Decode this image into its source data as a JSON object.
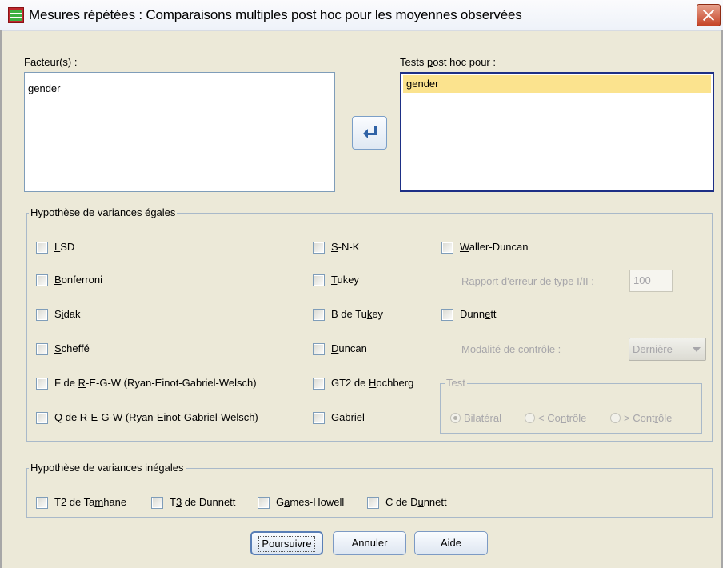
{
  "window": {
    "title": "Mesures répétées : Comparaisons multiples post hoc pour les moyennes observées"
  },
  "factors": {
    "label": "Facteur(s) :",
    "items": [
      "gender"
    ]
  },
  "posthoc_tests": {
    "label": "Tests post hoc pour :",
    "items": [
      "gender"
    ]
  },
  "equal_variances": {
    "legend": "Hypothèse de variances égales",
    "options": [
      {
        "label": "LSD",
        "checked": false
      },
      {
        "label": "Bonferroni",
        "checked": false
      },
      {
        "label": "Sidak",
        "checked": false
      },
      {
        "label": "Scheffé",
        "checked": false
      },
      {
        "label": "F de R-E-G-W (Ryan-Einot-Gabriel-Welsch)",
        "checked": false
      },
      {
        "label": "Q de R-E-G-W (Ryan-Einot-Gabriel-Welsch)",
        "checked": false
      },
      {
        "label": "S-N-K",
        "checked": false
      },
      {
        "label": "Tukey",
        "checked": false
      },
      {
        "label": "B de Tukey",
        "checked": false
      },
      {
        "label": "Duncan",
        "checked": false
      },
      {
        "label": "GT2 de Hochberg",
        "checked": false
      },
      {
        "label": "Gabriel",
        "checked": false
      },
      {
        "label": "Waller-Duncan",
        "checked": false
      },
      {
        "label": "Dunnett",
        "checked": false
      }
    ],
    "error_ratio_label": "Rapport d'erreur de type I/II :",
    "error_ratio_value": "100",
    "control_label": "Modalité de contrôle :",
    "control_value": "Dernière",
    "test_legend": "Test",
    "test_options": [
      {
        "label": "Bilatéral",
        "selected": true
      },
      {
        "label": "< Contrôle",
        "selected": false
      },
      {
        "label": "> Contrôle",
        "selected": false
      }
    ]
  },
  "unequal_variances": {
    "legend": "Hypothèse de variances inégales",
    "options": [
      {
        "label": "T2 de Tamhane",
        "checked": false
      },
      {
        "label": "T3 de Dunnett",
        "checked": false
      },
      {
        "label": "Games-Howell",
        "checked": false
      },
      {
        "label": "C de Dunnett",
        "checked": false
      }
    ]
  },
  "buttons": {
    "continue": "Poursuivre",
    "cancel": "Annuler",
    "help": "Aide"
  }
}
